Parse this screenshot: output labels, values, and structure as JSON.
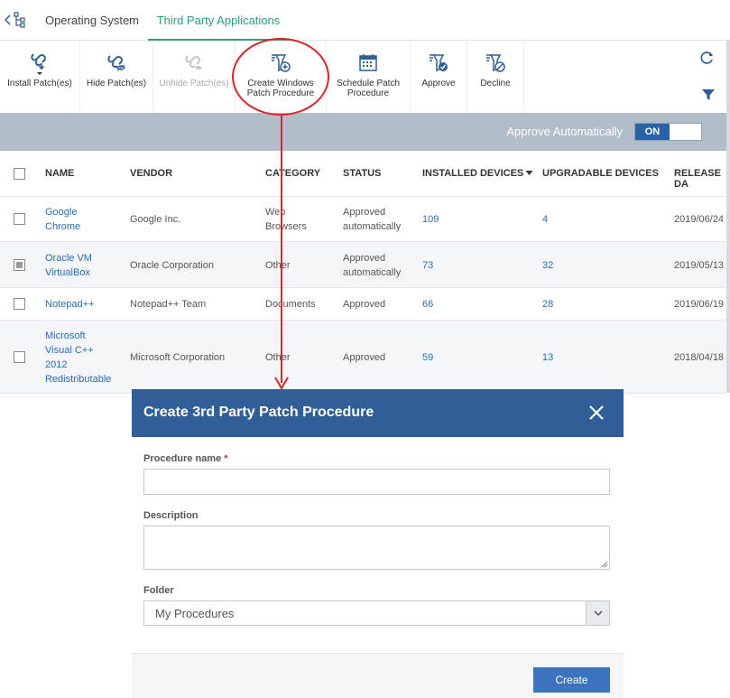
{
  "tabs": [
    {
      "label": "Operating System"
    },
    {
      "label": "Third Party Applications",
      "active": true
    }
  ],
  "toolbar": {
    "buttons": [
      {
        "label": "Install Patch(es)",
        "icon": "install-patch-icon"
      },
      {
        "label": "Hide Patch(es)",
        "icon": "hide-patch-icon"
      },
      {
        "label": "Unhide Patch(es)",
        "icon": "unhide-patch-icon",
        "disabled": true
      },
      {
        "label": "Create Windows\nPatch Procedure",
        "icon": "create-procedure-icon"
      },
      {
        "label": "Schedule Patch\nProcedure",
        "icon": "calendar-icon"
      },
      {
        "label": "Approve",
        "icon": "approve-icon"
      },
      {
        "label": "Decline",
        "icon": "decline-icon"
      }
    ]
  },
  "approve_bar": {
    "label": "Approve Automatically",
    "toggle": "ON"
  },
  "table": {
    "headers": [
      "NAME",
      "VENDOR",
      "CATEGORY",
      "STATUS",
      "INSTALLED DEVICES",
      "UPGRADABLE DEVICES",
      "RELEASE DA"
    ],
    "rows": [
      {
        "name": "Google\nChrome",
        "vendor": "Google Inc.",
        "category": "Web\nBrowsers",
        "status": "Approved\nautomatically",
        "installed": "109",
        "upgradable": "4",
        "release": "2019/06/24",
        "checked": false
      },
      {
        "name": "Oracle VM\nVirtualBox",
        "vendor": "Oracle Corporation",
        "category": "Other",
        "status": "Approved\nautomatically",
        "installed": "73",
        "upgradable": "32",
        "release": "2019/05/13",
        "checked": true
      },
      {
        "name": "Notepad++",
        "vendor": "Notepad++ Team",
        "category": "Documents",
        "status": "Approved",
        "installed": "66",
        "upgradable": "28",
        "release": "2019/06/19",
        "checked": false
      },
      {
        "name": "Microsoft\nVisual C++\n2012\nRedistributable",
        "vendor": "Microsoft Corporation",
        "category": "Other",
        "status": "Approved",
        "installed": "59",
        "upgradable": "13",
        "release": "2018/04/18",
        "checked": false
      }
    ]
  },
  "modal": {
    "title": "Create 3rd Party Patch Procedure",
    "fields": {
      "procedure_name_label": "Procedure name",
      "required_mark": "*",
      "procedure_name_value": "",
      "description_label": "Description",
      "description_value": "",
      "folder_label": "Folder",
      "folder_value": "My Procedures"
    },
    "create_label": "Create"
  },
  "colors": {
    "accent_green": "#2e9e74",
    "header_blue": "#2f5f96",
    "link_blue": "#2a6db2",
    "annotation_red": "#d9262b"
  }
}
